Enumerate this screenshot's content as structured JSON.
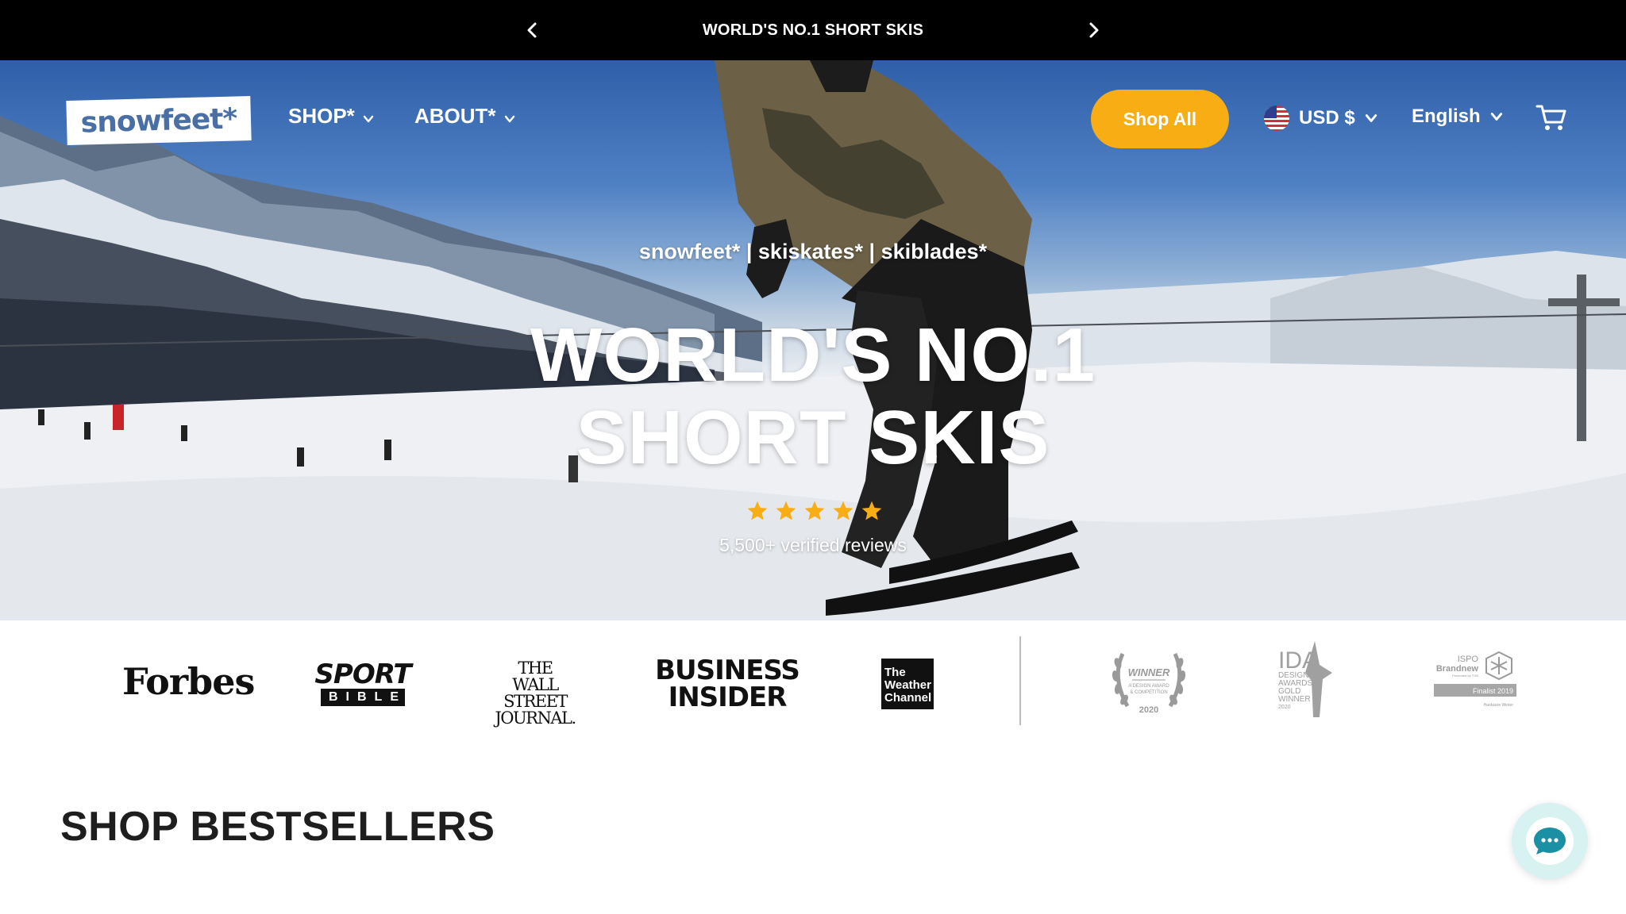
{
  "announcement": {
    "text": "WORLD'S NO.1 SHORT SKIS"
  },
  "header": {
    "logo_text": "snowfeet*",
    "menu": [
      {
        "label": "SHOP*"
      },
      {
        "label": "ABOUT*"
      }
    ],
    "shop_all_label": "Shop All",
    "currency_label": "USD $",
    "language_label": "English"
  },
  "hero": {
    "subtitle": "snowfeet* | skiskates* | skiblades*",
    "headline_line1": "WORLD'S NO.1",
    "headline_line2": "SHORT SKIS",
    "rating_stars": 5,
    "reviews_text": "5,500+ verified reviews"
  },
  "press": {
    "forbes": "Forbes",
    "sportbible_top": "SPORT",
    "sportbible_bottom": "BIBLE",
    "wsj_line1": "THE",
    "wsj_line2": "WALL STREET",
    "wsj_line3": "JOURNAL.",
    "bi_line1": "BUSINESS",
    "bi_line2": "INSIDER",
    "weather_line1": "The",
    "weather_line2": "Weather",
    "weather_line3": "Channel",
    "award1_title": "WINNER",
    "award1_sub1": "A'DESIGN AWARD",
    "award1_sub2": "& COMPETITION",
    "award1_year": "2020",
    "award2_title": "IDA",
    "award2_sub1": "DESIGN",
    "award2_sub2": "AWARDS",
    "award2_sub3": "GOLD",
    "award2_sub4": "WINNER",
    "award2_year": "2020",
    "award3_title1": "ISPO",
    "award3_title2": "Brandnew",
    "award3_presented": "Presented by TGB",
    "award3_badge": "Finalist 2019",
    "award3_category": "Hardware Winter"
  },
  "sections": {
    "bestsellers_title": "SHOP BESTSELLERS"
  },
  "colors": {
    "accent": "#f7ad13",
    "star": "#f7ad13",
    "chat_bg": "#d8f2f2",
    "chat_icon": "#1b8fa3",
    "logo_text": "#4a6fa5"
  },
  "icons": [
    "chevron-left-icon",
    "chevron-right-icon",
    "chevron-down-icon",
    "us-flag-icon",
    "cart-icon",
    "star-icon",
    "chat-icon"
  ]
}
